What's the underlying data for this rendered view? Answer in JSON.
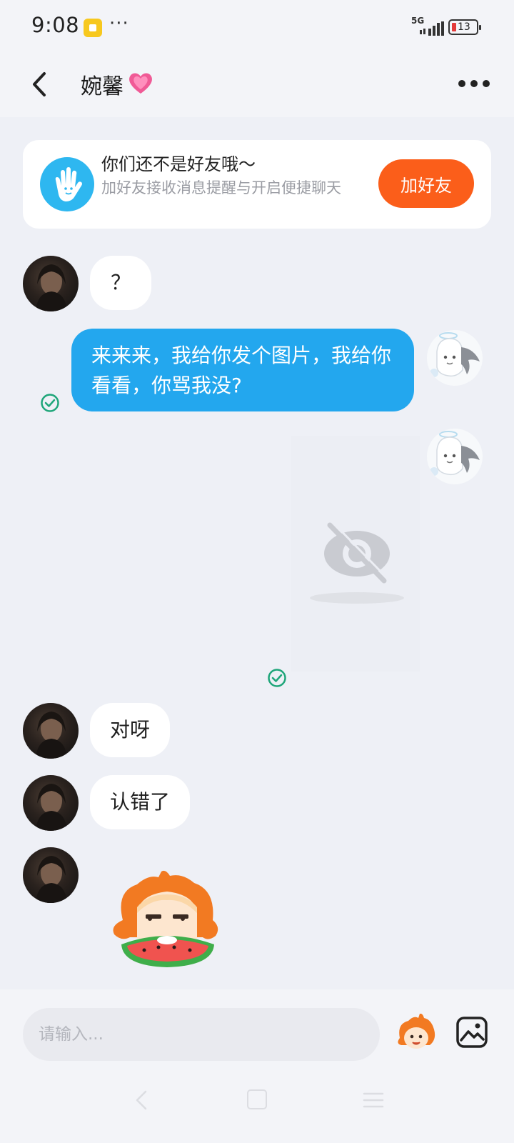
{
  "status_bar": {
    "time": "9:08",
    "more": "···",
    "network": "5G",
    "battery": "13"
  },
  "header": {
    "back_icon": "chevron-left-icon",
    "title": "婉馨",
    "title_emoji": "pink-heart-icon",
    "more_icon": "more-dots-icon"
  },
  "friend_banner": {
    "icon": "hand-wave-icon",
    "title": "你们还不是好友哦～",
    "subtitle": "加好友接收消息提醒与开启便捷聊天",
    "button_label": "加好友",
    "button_color": "#fb5e1a"
  },
  "messages": [
    {
      "sender": "other",
      "text": "？"
    },
    {
      "sender": "self",
      "text": "来来来，我给你发个图片，我给你看看，你骂我没?",
      "status": "read"
    },
    {
      "sender": "self",
      "type": "image",
      "icon": "hidden-eye-icon",
      "status": "read"
    },
    {
      "sender": "other",
      "text": "对呀"
    },
    {
      "sender": "other",
      "text": "认错了"
    },
    {
      "sender": "other",
      "type": "sticker",
      "icon": "watermelon-sticker-icon"
    }
  ],
  "input_bar": {
    "placeholder": "请输入...",
    "emoji_icon": "emoji-sticker-icon",
    "image_icon": "image-icon"
  },
  "colors": {
    "outgoing_bubble": "#23a7ee",
    "incoming_bubble": "#ffffff",
    "read_check": "#1fa67a",
    "background": "#eef0f6"
  }
}
